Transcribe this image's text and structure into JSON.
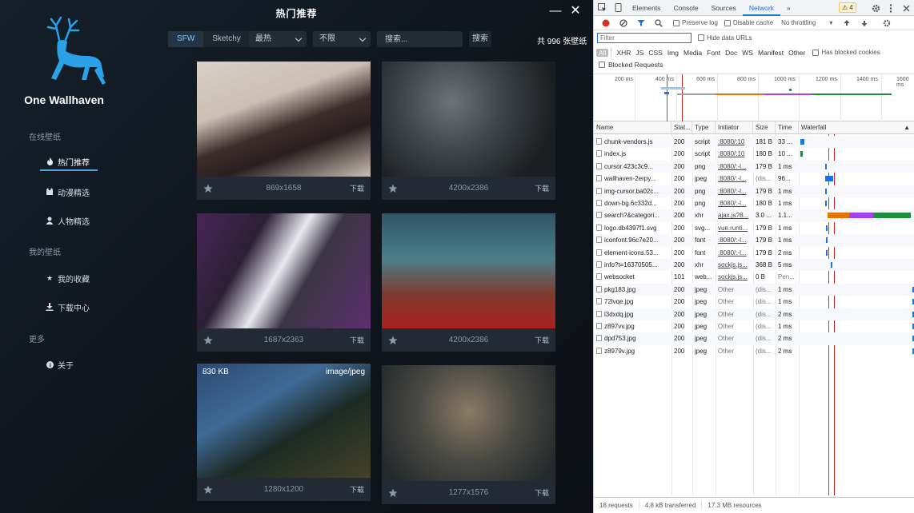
{
  "app": {
    "title": "热门推荐",
    "name": "One Wallhaven",
    "brand_color": "#2aa1e8",
    "nav": [
      {
        "type": "section",
        "label": "在线壁纸"
      },
      {
        "type": "item",
        "label": "热门推荐",
        "icon": "fire-icon",
        "active": true
      },
      {
        "type": "item",
        "label": "动漫精选",
        "icon": "anime-icon"
      },
      {
        "type": "item",
        "label": "人物精选",
        "icon": "person-icon"
      },
      {
        "type": "section",
        "label": "我的壁纸"
      },
      {
        "type": "item",
        "label": "我的收藏",
        "icon": "star-icon"
      },
      {
        "type": "item",
        "label": "下载中心",
        "icon": "download-icon"
      },
      {
        "type": "section",
        "label": "更多"
      },
      {
        "type": "item",
        "label": "关于",
        "icon": "info-icon"
      }
    ],
    "filters": {
      "sfw": "SFW",
      "sketchy": "Sketchy",
      "sort": "最热",
      "range": "不限",
      "search_placeholder": "搜索...",
      "search_button": "搜索",
      "total": "共 996 张壁纸"
    },
    "cards": [
      {
        "resolution": "869x1658",
        "download": "下载"
      },
      {
        "resolution": "4200x2386",
        "download": "下载"
      },
      {
        "resolution": "1687x2363",
        "download": "下载"
      },
      {
        "resolution": "4200x2386",
        "download": "下载"
      },
      {
        "resolution": "1280x1200",
        "download": "下载",
        "size": "830 KB",
        "mime": "image/jpeg"
      },
      {
        "resolution": "1277x1576",
        "download": "下载"
      }
    ]
  },
  "devtools": {
    "tabs": [
      "Elements",
      "Console",
      "Sources",
      "Network"
    ],
    "active_tab": "Network",
    "warnings": "4",
    "toolbar": {
      "preserve_log": "Preserve log",
      "disable_cache": "Disable cache",
      "throttling": "No throttling"
    },
    "filter_placeholder": "Filter",
    "hide_data_urls": "Hide data URLs",
    "types": [
      "All",
      "XHR",
      "JS",
      "CSS",
      "Img",
      "Media",
      "Font",
      "Doc",
      "WS",
      "Manifest",
      "Other"
    ],
    "has_blocked_cookies": "Has blocked cookies",
    "blocked_requests": "Blocked Requests",
    "timeline_ticks": [
      "200 ms",
      "400 ms",
      "600 ms",
      "800 ms",
      "1000 ms",
      "1200 ms",
      "1400 ms",
      "1600 ms"
    ],
    "columns": [
      "Name",
      "Stat...",
      "Type",
      "Initiator",
      "Size",
      "Time",
      "Waterfall"
    ],
    "rows": [
      {
        "name": "chunk-vendors.js",
        "status": "200",
        "type": "script",
        "initiator": ":8080/:10",
        "size": "181 B",
        "time": "33 ..."
      },
      {
        "name": "index.js",
        "status": "200",
        "type": "script",
        "initiator": ":8080/:10",
        "size": "180 B",
        "time": "10 ..."
      },
      {
        "name": "cursor.423c3c9...",
        "status": "200",
        "type": "png",
        "initiator": ":8080/:-l...",
        "size": "179 B",
        "time": "1 ms"
      },
      {
        "name": "wallhaven-2erpy...",
        "status": "200",
        "type": "jpeg",
        "initiator": ":8080/:-l...",
        "size": "(dis...",
        "time": "96..."
      },
      {
        "name": "img-cursor.ba02c...",
        "status": "200",
        "type": "png",
        "initiator": ":8080/:-l...",
        "size": "179 B",
        "time": "1 ms"
      },
      {
        "name": "down-bg.6c332d...",
        "status": "200",
        "type": "png",
        "initiator": ":8080/:-l...",
        "size": "180 B",
        "time": "1 ms"
      },
      {
        "name": "search?&categori...",
        "status": "200",
        "type": "xhr",
        "initiator": "ajax.js?8...",
        "size": "3.0 ...",
        "time": "1.1..."
      },
      {
        "name": "logo.db4397f1.svg",
        "status": "200",
        "type": "svg...",
        "initiator": "vue.runti...",
        "size": "179 B",
        "time": "1 ms"
      },
      {
        "name": "iconfont.96c7e20...",
        "status": "200",
        "type": "font",
        "initiator": ":8080/:-l...",
        "size": "179 B",
        "time": "1 ms"
      },
      {
        "name": "element-icons.53...",
        "status": "200",
        "type": "font",
        "initiator": ":8080/:-l...",
        "size": "179 B",
        "time": "2 ms"
      },
      {
        "name": "info?t=16370505...",
        "status": "200",
        "type": "xhr",
        "initiator": "sockjs.js...",
        "size": "368 B",
        "time": "5 ms"
      },
      {
        "name": "websocket",
        "status": "101",
        "type": "web...",
        "initiator": "sockjs.js...",
        "size": "0 B",
        "time": "Pen..."
      },
      {
        "name": "pkg183.jpg",
        "status": "200",
        "type": "jpeg",
        "initiator": "Other",
        "size": "(dis...",
        "time": "1 ms"
      },
      {
        "name": "72lvqe.jpg",
        "status": "200",
        "type": "jpeg",
        "initiator": "Other",
        "size": "(dis...",
        "time": "1 ms"
      },
      {
        "name": "l3dxdq.jpg",
        "status": "200",
        "type": "jpeg",
        "initiator": "Other",
        "size": "(dis...",
        "time": "2 ms"
      },
      {
        "name": "z897vv.jpg",
        "status": "200",
        "type": "jpeg",
        "initiator": "Other",
        "size": "(dis...",
        "time": "1 ms"
      },
      {
        "name": "dpd753.jpg",
        "status": "200",
        "type": "jpeg",
        "initiator": "Other",
        "size": "(dis...",
        "time": "2 ms"
      },
      {
        "name": "z8979v.jpg",
        "status": "200",
        "type": "jpeg",
        "initiator": "Other",
        "size": "(dis...",
        "time": "2 ms"
      }
    ],
    "status": {
      "requests": "18 requests",
      "transferred": "4.8 kB transferred",
      "resources": "17.3 MB resources"
    }
  }
}
